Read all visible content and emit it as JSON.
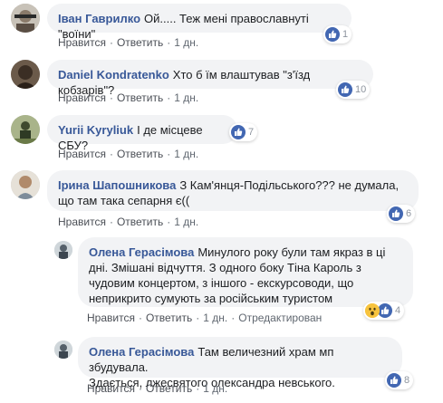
{
  "comments": [
    {
      "author": "Іван Гаврилко",
      "text": "Ой..... Теж мені православнуті \"воїни\"",
      "actions": {
        "like": "Нравится",
        "reply": "Ответить",
        "time": "1 дн."
      },
      "reactions": {
        "count": "1",
        "types": [
          "like"
        ]
      }
    },
    {
      "author": "Daniel Kondratenko",
      "text": "Хто б їм влаштував \"з'їзд кобзарів\"?",
      "actions": {
        "like": "Нравится",
        "reply": "Ответить",
        "time": "1 дн."
      },
      "reactions": {
        "count": "10",
        "types": [
          "like"
        ]
      }
    },
    {
      "author": "Yurii Kyryliuk",
      "text": "І де місцеве СБУ?",
      "actions": {
        "like": "Нравится",
        "reply": "Ответить",
        "time": "1 дн."
      },
      "reactions": {
        "count": "7",
        "types": [
          "like"
        ]
      }
    },
    {
      "author": "Ірина Шапошникова",
      "text_line1": "З Кам'янця-Подільського??? не думала,",
      "text_line2": "що там така сепарня є((",
      "actions": {
        "like": "Нравится",
        "reply": "Ответить",
        "time": "1 дн."
      },
      "reactions": {
        "count": "6",
        "types": [
          "like"
        ]
      }
    }
  ],
  "replies": [
    {
      "author": "Олена Герасімова",
      "lines": [
        "Минулого року були там якраз в ці",
        "дні. Змішані відчуття. З одного боку Тіна Кароль з",
        "чудовим концертом, з іншого - екскурсоводи, що",
        "неприкрито сумують за російським туристом"
      ],
      "actions": {
        "like": "Нравится",
        "reply": "Ответить",
        "time": "1 дн.",
        "edited": "Отредактирован"
      },
      "reactions": {
        "count": "4",
        "types": [
          "wow",
          "like"
        ]
      }
    },
    {
      "author": "Олена Герасімова",
      "lines": [
        "Там величезний храм мп збудувала.",
        "Здається, лжесвятого олександра невського."
      ],
      "actions": {
        "like": "Нравится",
        "reply": "Ответить",
        "time": "1 дн."
      },
      "reactions": {
        "count": "8",
        "types": [
          "like"
        ]
      }
    }
  ]
}
